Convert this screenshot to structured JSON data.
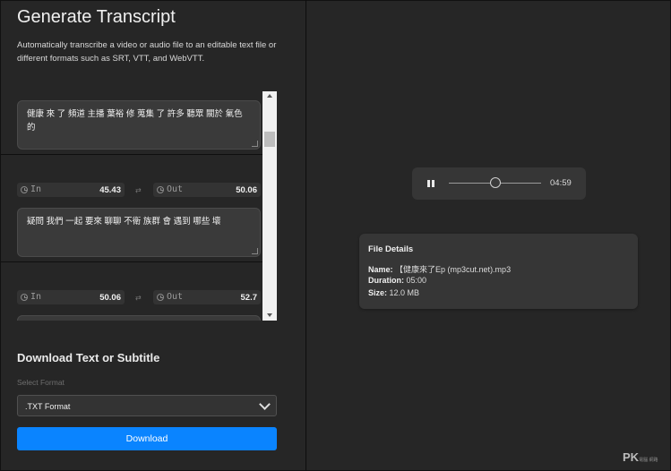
{
  "left": {
    "title": "Generate Transcript",
    "description": "Automatically transcribe a video or audio file to an editable text file or different formats such as SRT, VTT, and WebVTT."
  },
  "segments": [
    {
      "text": "健康 來 了 頻道 主播 葉裕 修 蒐集 了 許多 聽眾 關於 氣色 的"
    },
    {
      "in_label": "In",
      "in_value": "45.43",
      "out_label": "Out",
      "out_value": "50.06",
      "text": "疑問 我們 一起 要來 聊聊 不衛 族群 會 遇到 哪些 壞"
    },
    {
      "in_label": "In",
      "in_value": "50.06",
      "out_label": "Out",
      "out_value": "52.7"
    }
  ],
  "download": {
    "title": "Download Text or Subtitle",
    "select_label": "Select Format",
    "selected_format": ".TXT Format",
    "button_label": "Download"
  },
  "player": {
    "duration": "04:59",
    "progress": 0.5
  },
  "file_details": {
    "title": "File Details",
    "name_label": "Name:",
    "name_value": "【健康來了Ep (mp3cut.net).mp3",
    "duration_label": "Duration:",
    "duration_value": "05:00",
    "size_label": "Size:",
    "size_value": "12.0 MB"
  },
  "watermark": {
    "text": "PK",
    "sub": "電腦 網路"
  },
  "colors": {
    "accent": "#0a84ff",
    "panel": "#262626",
    "card": "#363636"
  }
}
